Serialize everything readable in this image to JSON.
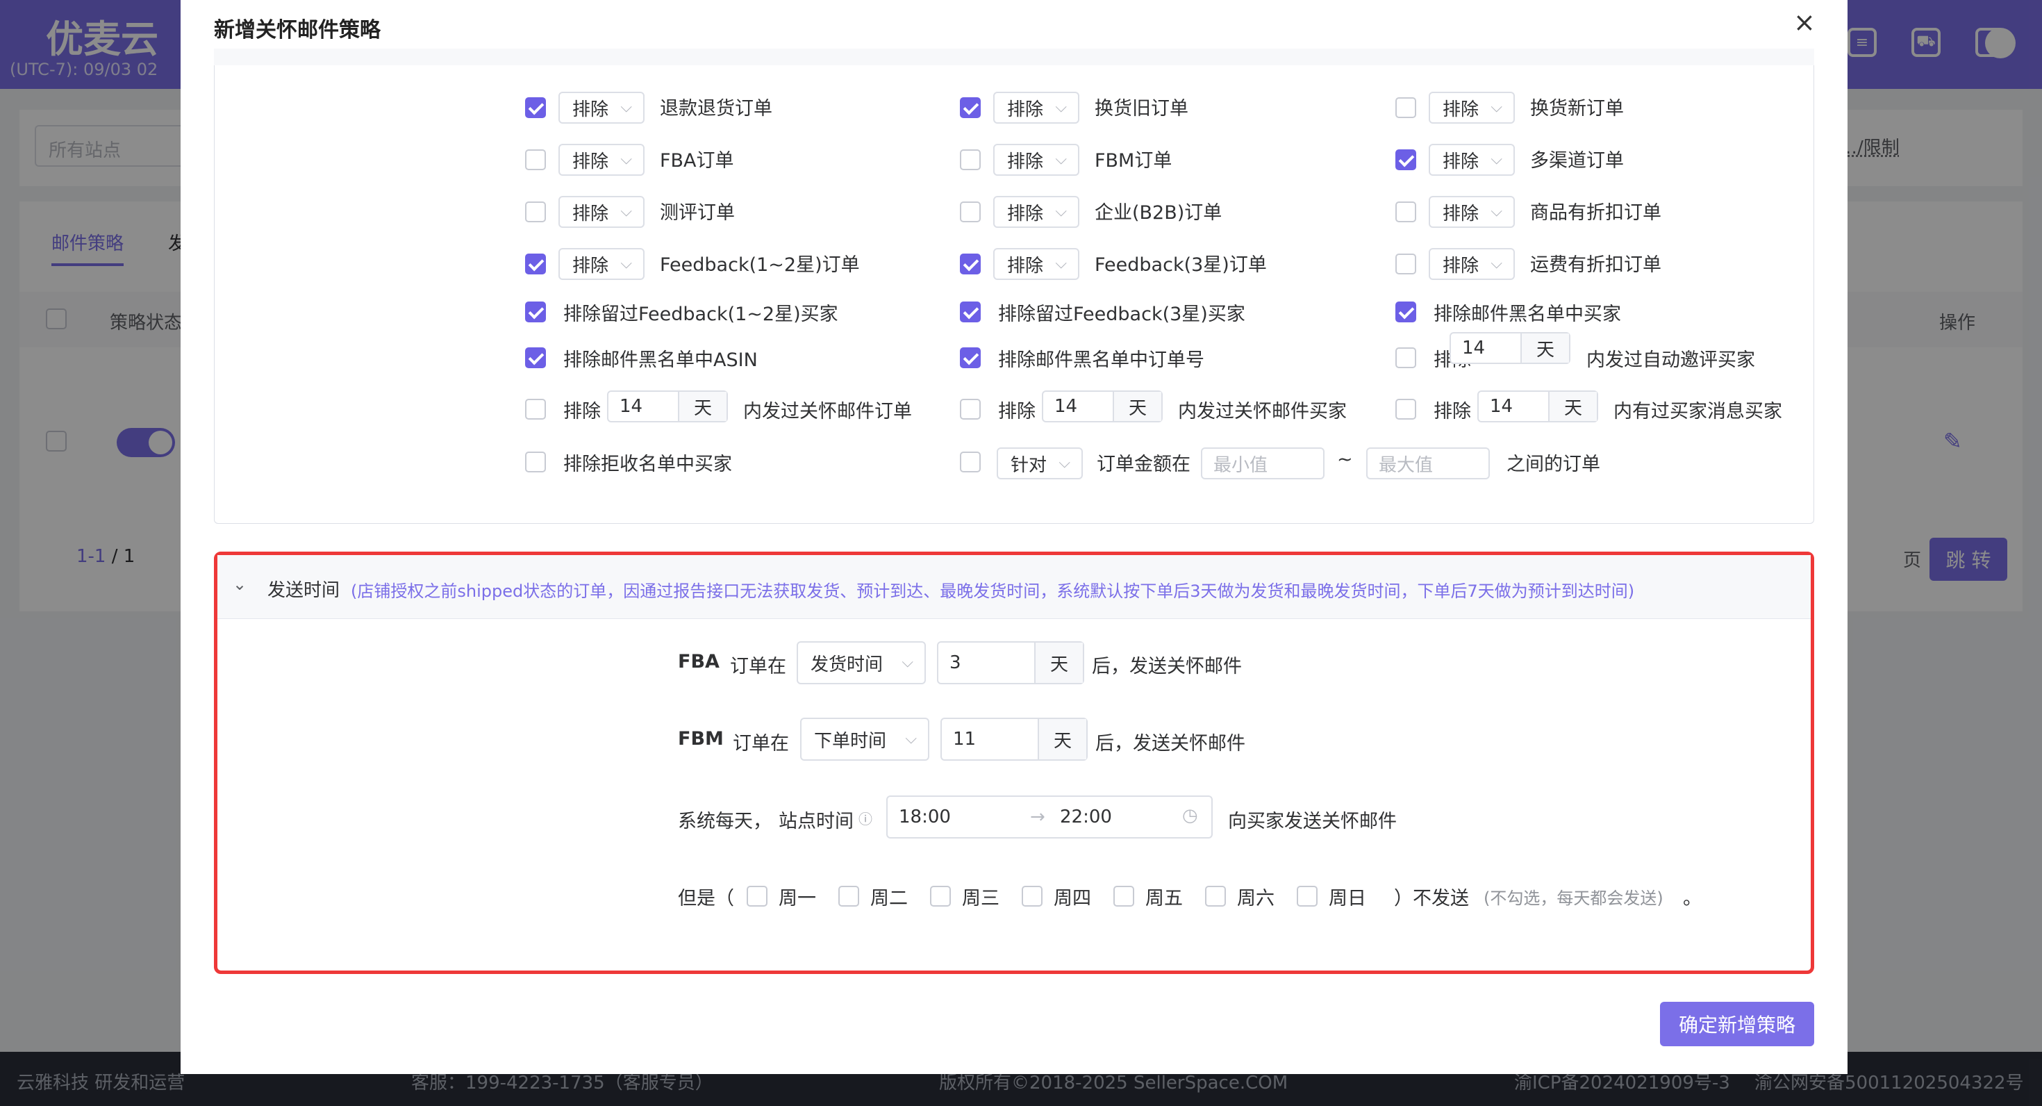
{
  "background": {
    "logo": "优麦云",
    "timezone": "(UTC-7): 09/03 02",
    "site_select_placeholder": "所有站点",
    "restrict_link": "…/限制",
    "tabs": [
      "邮件策略",
      "发"
    ],
    "columns": {
      "status": "策略状态",
      "ops": "操作"
    },
    "pagination": {
      "range": "1-1",
      "total": "/ 1",
      "page_suffix": "页",
      "jump": "跳 转"
    },
    "footer": {
      "company": "云雅科技 研发和运营",
      "service": "客服：199-4223-1735（客服专员）",
      "copyright": "版权所有©2018-2025 SellerSpace.COM",
      "icp": "渝ICP备2024021909号-3",
      "police": "渝公网安备50011202504322号"
    }
  },
  "modal": {
    "title": "新增关怀邮件策略",
    "close": "×",
    "exclude_label": "排除",
    "rows": [
      {
        "cols": [
          {
            "checked": true,
            "text": "退款退货订单"
          },
          {
            "checked": true,
            "text": "换货旧订单"
          },
          {
            "checked": false,
            "text": "换货新订单"
          }
        ]
      },
      {
        "cols": [
          {
            "checked": false,
            "text": "FBA订单"
          },
          {
            "checked": false,
            "text": "FBM订单"
          },
          {
            "checked": true,
            "text": "多渠道订单"
          }
        ]
      },
      {
        "cols": [
          {
            "checked": false,
            "text": "测评订单"
          },
          {
            "checked": false,
            "text": "企业(B2B)订单"
          },
          {
            "checked": false,
            "text": "商品有折扣订单"
          }
        ]
      },
      {
        "cols": [
          {
            "checked": true,
            "text": "Feedback(1~2星)订单"
          },
          {
            "checked": true,
            "text": "Feedback(3星)订单"
          },
          {
            "checked": false,
            "text": "运费有折扣订单"
          }
        ]
      }
    ],
    "plain_rows": [
      [
        {
          "checked": true,
          "text": "排除留过Feedback(1~2星)买家"
        },
        {
          "checked": true,
          "text": "排除留过Feedback(3星)买家"
        },
        {
          "checked": true,
          "text": "排除邮件黑名单中买家"
        }
      ],
      [
        {
          "checked": true,
          "text": "排除邮件黑名单中ASIN"
        },
        {
          "checked": true,
          "text": "排除邮件黑名单中订单号"
        },
        {
          "checked": false,
          "text": "排除"
        }
      ]
    ],
    "auto_invite": {
      "days": "14",
      "unit": "天",
      "suffix": "内发过自动邀评买家"
    },
    "day_rows": [
      {
        "checked": false,
        "label": "排除",
        "days": "14",
        "unit": "天",
        "suffix": "内发过关怀邮件订单"
      },
      {
        "checked": false,
        "label": "排除",
        "days": "14",
        "unit": "天",
        "suffix": "内发过关怀邮件买家"
      },
      {
        "checked": false,
        "label": "排除",
        "days": "14",
        "unit": "天",
        "suffix": "内有过买家消息买家"
      }
    ],
    "reject_list": {
      "checked": false,
      "text": "排除拒收名单中买家"
    },
    "amount": {
      "checked": false,
      "select": "针对",
      "label": "订单金额在",
      "min_placeholder": "最小值",
      "tilde": "~",
      "max_placeholder": "最大值",
      "suffix": "之间的订单"
    },
    "send_time": {
      "title": "发送时间",
      "note": "(店铺授权之前shipped状态的订单，因通过报告接口无法获取发货、预计到达、最晚发货时间，系统默认按下单后3天做为发货和最晚发货时间，下单后7天做为预计到达时间)",
      "fba": {
        "tag": "FBA",
        "label": "订单在",
        "select": "发货时间",
        "value": "3",
        "unit": "天",
        "suffix": "后，发送关怀邮件"
      },
      "fbm": {
        "tag": "FBM",
        "label": "订单在",
        "select": "下单时间",
        "value": "11",
        "unit": "天",
        "suffix": "后，发送关怀邮件"
      },
      "daily": {
        "prefix": "系统每天，",
        "site_time": "站点时间",
        "start": "18:00",
        "arrow": "→",
        "end": "22:00",
        "suffix": "向买家发送关怀邮件"
      },
      "weekdays": {
        "prefix": "但是（",
        "days": [
          "周一",
          "周二",
          "周三",
          "周四",
          "周五",
          "周六",
          "周日"
        ],
        "close": "）不发送",
        "hint": "(不勾选，每天都会发送)",
        "end": "。"
      }
    },
    "confirm": "确定新增策略"
  },
  "colors": {
    "accent": "#7b6fe8",
    "highlight_border": "#ee3838",
    "note": "#7b6fe8"
  }
}
